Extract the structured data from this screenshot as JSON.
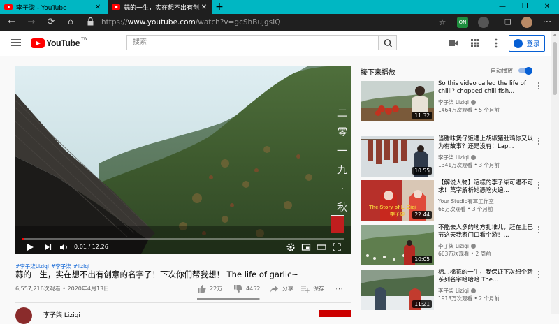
{
  "colors": {
    "accent": "#065fd4",
    "brand_red": "#ff0000",
    "tab_strip": "#00b7c3",
    "chrome_dark": "#1f1f1f"
  },
  "browser": {
    "tabs": [
      {
        "title": "李子柒 - YouTube",
        "active": false
      },
      {
        "title": "蒜的一生，实在想不出有创意的",
        "active": true
      }
    ],
    "url_prefix": "https://",
    "url_host": "www.youtube.com",
    "url_path": "/watch?v=gcShBujgsIQ",
    "extension_on_label": "ON"
  },
  "masthead": {
    "logo_text": "YouTube",
    "logo_tm": "TW",
    "search_placeholder": "搜索",
    "signin_label": "登录"
  },
  "player": {
    "overlay_text": [
      "二",
      "零",
      "一",
      "九",
      "·",
      "秋"
    ],
    "current_time": "0:01",
    "duration": "12:26",
    "time_separator": "/",
    "progress_fraction": 0.002
  },
  "video": {
    "hashtags": [
      "#李子柒Liziqi",
      "#李子柒",
      "#liziqi"
    ],
    "title": "蒜的一生，实在想不出有创意的名字了！下次你们帮我想！ The life of garlic~",
    "views_date": "6,557,216次观看 • 2020年4月13日",
    "likes": "22万",
    "dislikes": "4452",
    "share_label": "分享",
    "save_label": "保存",
    "like_ratio": 0.98
  },
  "up_next": {
    "header": "接下来播放",
    "autoplay_label": "自动播放",
    "autoplay_on": true,
    "items": [
      {
        "title": "So this video called the life of chilli? chopped chili fish...",
        "channel": "李子柒 Liziqi",
        "meta": "1464万次观看 • 5 个月前",
        "duration": "11:32"
      },
      {
        "title": "当腊味煲仔饭遇上胡椒猪肚鸡你又以为有故事？还是没有！Lap...",
        "channel": "李子柒 Liziqi",
        "meta": "1341万次观看 • 3 个月前",
        "duration": "10:55"
      },
      {
        "title": "【解说人物】這樣的李子柒可遇不可求！萬字解析她憑啥火遍...",
        "channel": "Your Studio有耳工作室",
        "meta": "66万次观看 • 3 个月前",
        "duration": "22:44",
        "thumb_caption": "The Story of Li Ziqi",
        "thumb_caption2": "李子柒"
      },
      {
        "title": "不能去人多的地方扎堆儿，赶在上巳节这天我家门口看个游！...",
        "channel": "李子柒 Liziqi",
        "meta": "663万次观看 • 2 周前",
        "duration": "10:05"
      },
      {
        "title": "棉...棉花的一生，我保证下次想个新系列名字哈哈哈 The...",
        "channel": "李子柒 Liziqi",
        "meta": "1913万次观看 • 2 个月前",
        "duration": "11:21"
      }
    ]
  },
  "channel": {
    "name_partial": "李子柒 Liziqi"
  }
}
